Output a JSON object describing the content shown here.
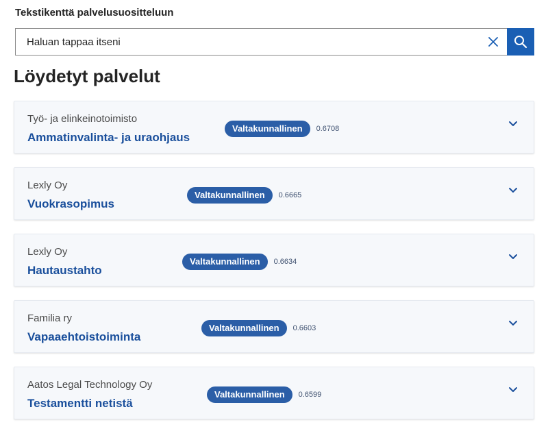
{
  "search": {
    "label": "Tekstikenttä palvelusuositteluun",
    "value": "Haluan tappaa itseni",
    "clear_icon": "close-icon",
    "submit_icon": "search-icon",
    "accent_color": "#1a5fb4"
  },
  "results": {
    "title": "Löydetyt palvelut",
    "items": [
      {
        "provider": "Työ- ja elinkeinotoimisto",
        "name": "Ammatinvalinta- ja uraohjaus",
        "badge": "Valtakunnallinen",
        "score": "0.6708"
      },
      {
        "provider": "Lexly Oy",
        "name": "Vuokrasopimus",
        "badge": "Valtakunnallinen",
        "score": "0.6665"
      },
      {
        "provider": "Lexly Oy",
        "name": "Hautaustahto",
        "badge": "Valtakunnallinen",
        "score": "0.6634"
      },
      {
        "provider": "Familia ry",
        "name": "Vapaaehtoistoiminta",
        "badge": "Valtakunnallinen",
        "score": "0.6603"
      },
      {
        "provider": "Aatos Legal Technology Oy",
        "name": "Testamentti netistä",
        "badge": "Valtakunnallinen",
        "score": "0.6599"
      }
    ],
    "badge_color": "#2b5ea7",
    "name_color": "#1a4f9c",
    "expand_icon": "chevron-down-icon"
  }
}
